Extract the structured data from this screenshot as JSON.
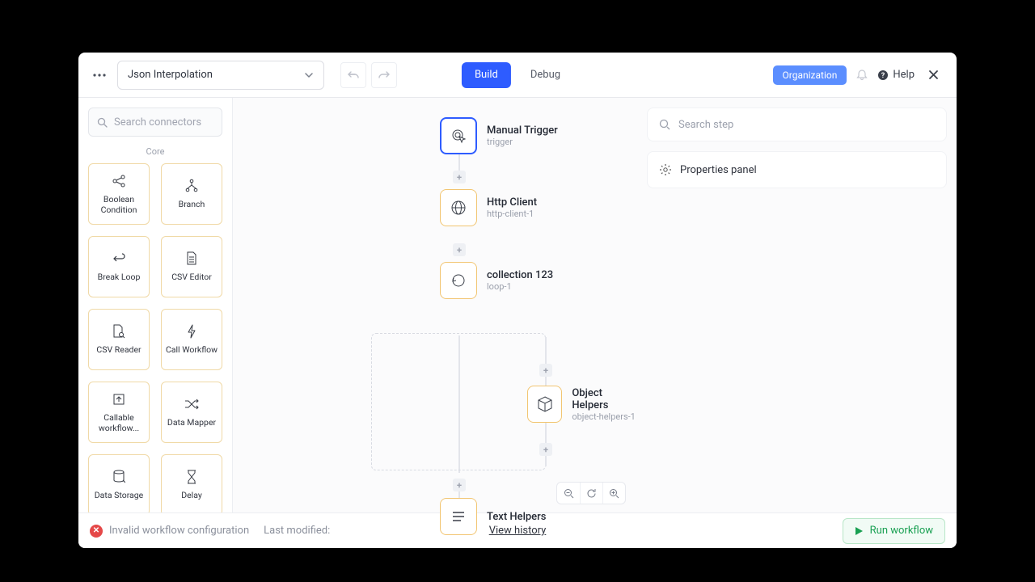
{
  "topbar": {
    "workflow_name": "Json Interpolation",
    "tabs": {
      "build": "Build",
      "debug": "Debug"
    },
    "org_badge": "Organization",
    "help_label": "Help"
  },
  "sidebar": {
    "search_placeholder": "Search connectors",
    "section_label": "Core",
    "connectors": [
      {
        "label": "Boolean Condition",
        "icon": "share"
      },
      {
        "label": "Branch",
        "icon": "branch"
      },
      {
        "label": "Break Loop",
        "icon": "return"
      },
      {
        "label": "CSV Editor",
        "icon": "file-lines"
      },
      {
        "label": "CSV Reader",
        "icon": "file-search"
      },
      {
        "label": "Call Workflow",
        "icon": "bolt"
      },
      {
        "label": "Callable workflow...",
        "icon": "upload"
      },
      {
        "label": "Data Mapper",
        "icon": "shuffle"
      },
      {
        "label": "Data Storage",
        "icon": "database"
      },
      {
        "label": "Delay",
        "icon": "hourglass"
      }
    ]
  },
  "canvas": {
    "nodes": {
      "n0": {
        "title": "Manual Trigger",
        "sub": "trigger"
      },
      "n1": {
        "title": "Http Client",
        "sub": "http-client-1"
      },
      "n2": {
        "title": "collection 123",
        "sub": "loop-1"
      },
      "n3": {
        "title": "Object Helpers",
        "sub": "object-helpers-1"
      },
      "n4": {
        "title": "Text Helpers",
        "sub": ""
      }
    }
  },
  "right": {
    "search_placeholder": "Search step",
    "props_label": "Properties panel"
  },
  "bottom": {
    "error_text": "Invalid workflow configuration",
    "lastmod_label": "Last modified:",
    "view_history": "View history",
    "run_label": "Run workflow"
  }
}
